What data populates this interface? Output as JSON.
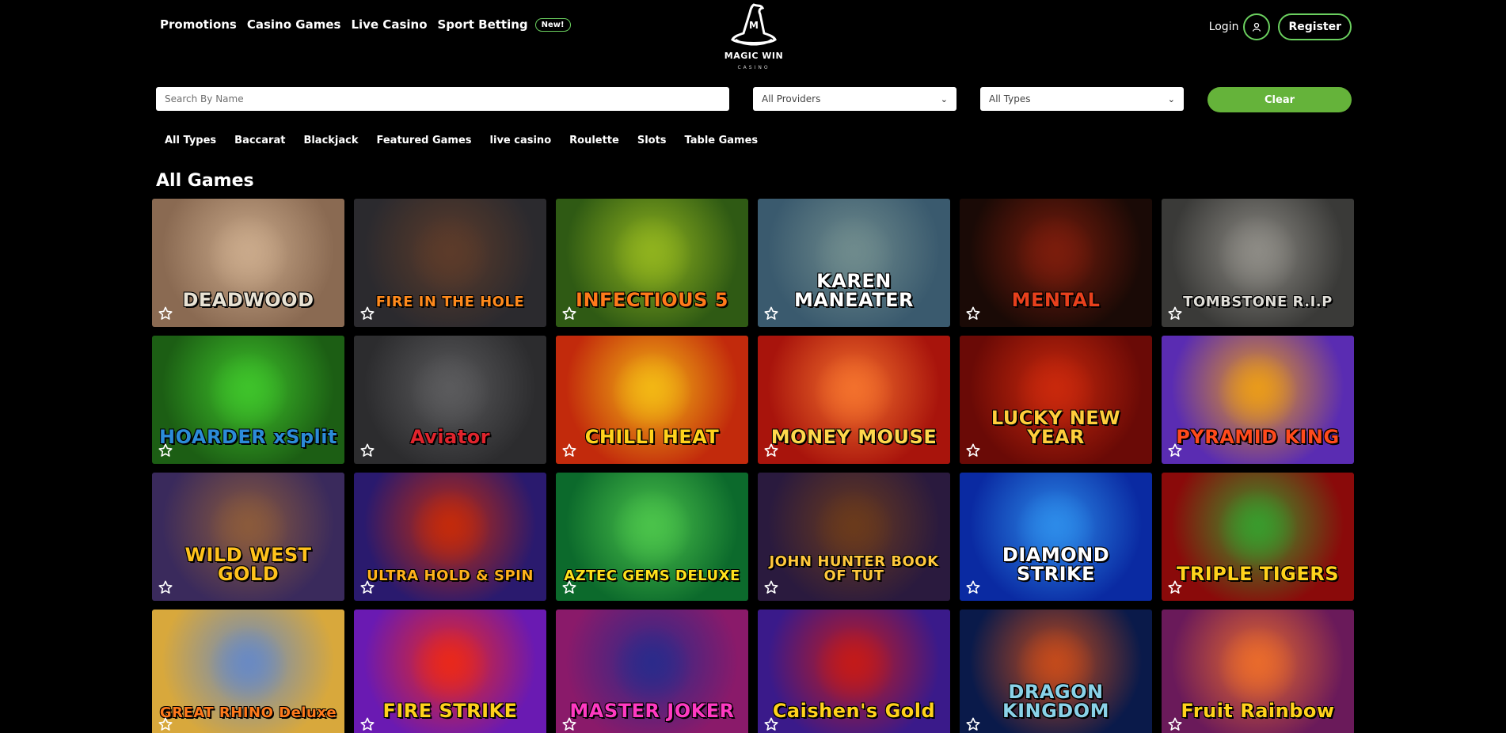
{
  "nav": {
    "items": [
      "Promotions",
      "Casino Games",
      "Live Casino",
      "Sport Betting"
    ],
    "new_badge": "New!"
  },
  "logo": {
    "text": "MAGIC WIN",
    "sub": "CASINO"
  },
  "auth": {
    "login": "Login",
    "register": "Register"
  },
  "filters": {
    "search_placeholder": "Search By Name",
    "providers": "All Providers",
    "types": "All Types",
    "clear": "Clear"
  },
  "tabs": [
    "All Types",
    "Baccarat",
    "Blackjack",
    "Featured Games",
    "live casino",
    "Roulette",
    "Slots",
    "Table Games"
  ],
  "section_title": "All Games",
  "games": [
    {
      "title": "DEADWOOD",
      "bg": "#8a6a52",
      "bg2": "#c9a98a",
      "fg": "#e8e2d4"
    },
    {
      "title": "FIRE IN THE HOLE",
      "bg": "#2b2a2e",
      "bg2": "#5c3b2a",
      "fg": "#ff8a1c"
    },
    {
      "title": "INFECTIOUS 5",
      "bg": "#2f5a14",
      "bg2": "#8fb21e",
      "fg": "#ff7a1a"
    },
    {
      "title": "KAREN MANEATER",
      "bg": "#3a5a6e",
      "bg2": "#6e8a8c",
      "fg": "#ffffff"
    },
    {
      "title": "MENTAL",
      "bg": "#1a0a06",
      "bg2": "#7a1c0c",
      "fg": "#e8401c"
    },
    {
      "title": "TOMBSTONE R.I.P",
      "bg": "#3a3a38",
      "bg2": "#8c8a84",
      "fg": "#e0ded8"
    },
    {
      "title": "HOARDER xSplit",
      "bg": "#1c5e14",
      "bg2": "#3ec22a",
      "fg": "#2c8bd8"
    },
    {
      "title": "Aviator",
      "bg": "#2c2c2e",
      "bg2": "#5a5a5c",
      "fg": "#e0242c"
    },
    {
      "title": "CHILLI HEAT",
      "bg": "#c22a0c",
      "bg2": "#f2b614",
      "fg": "#ffd21c"
    },
    {
      "title": "MONEY MOUSE",
      "bg": "#a8140c",
      "bg2": "#f2702c",
      "fg": "#ffd84c"
    },
    {
      "title": "LUCKY NEW YEAR",
      "bg": "#6a0a06",
      "bg2": "#c8280c",
      "fg": "#ffce3c"
    },
    {
      "title": "PYRAMID KING",
      "bg": "#5a2cb2",
      "bg2": "#e89a1c",
      "fg": "#ff4a1c"
    },
    {
      "title": "WILD WEST GOLD",
      "bg": "#3a2a5c",
      "bg2": "#8a5a3c",
      "fg": "#ffc21c"
    },
    {
      "title": "ULTRA HOLD & SPIN",
      "bg": "#2a1a6e",
      "bg2": "#c22a0c",
      "fg": "#ffb21c"
    },
    {
      "title": "AZTEC GEMS DELUXE",
      "bg": "#0c6a2c",
      "bg2": "#4ac24a",
      "fg": "#ffe21c"
    },
    {
      "title": "JOHN HUNTER BOOK OF TUT",
      "bg": "#2a1a3e",
      "bg2": "#6a3a1c",
      "fg": "#ffc83c"
    },
    {
      "title": "DIAMOND STRIKE",
      "bg": "#0a2aa2",
      "bg2": "#2c8ae8",
      "fg": "#ffffff"
    },
    {
      "title": "TRIPLE TIGERS",
      "bg": "#8a0a0a",
      "bg2": "#3a9a2c",
      "fg": "#ffd21c"
    },
    {
      "title": "GREAT RHINO Deluxe",
      "bg": "#d8a83c",
      "bg2": "#6a8ac2",
      "fg": "#ff7a1c"
    },
    {
      "title": "FIRE STRIKE",
      "bg": "#6a1ab2",
      "bg2": "#e8281c",
      "fg": "#ffd21c"
    },
    {
      "title": "MASTER JOKER",
      "bg": "#8a1a6a",
      "bg2": "#2c2a8a",
      "fg": "#ff3ac2"
    },
    {
      "title": "Caishen's Gold",
      "bg": "#3a1a8a",
      "bg2": "#c21a1a",
      "fg": "#ffd21c"
    },
    {
      "title": "DRAGON KINGDOM",
      "bg": "#0a1a4a",
      "bg2": "#c24a1c",
      "fg": "#8ad2e8"
    },
    {
      "title": "Fruit Rainbow",
      "bg": "#6a1a5a",
      "bg2": "#e86a2c",
      "fg": "#ffd21c"
    }
  ],
  "colors": {
    "accent": "#65b33a",
    "outline": "#6bd05f",
    "background": "#000000"
  }
}
